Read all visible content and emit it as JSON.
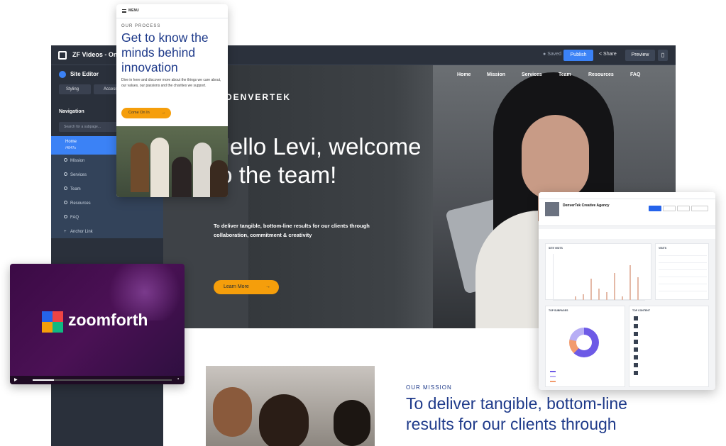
{
  "editor": {
    "title": "ZF Videos - Onboa",
    "saved": "Saved",
    "publish": "Publish",
    "share": "Share",
    "preview": "Preview"
  },
  "sidebar": {
    "heading": "Site Editor",
    "tab_styling": "Styling",
    "tab_access": "Access",
    "nav_heading": "Navigation",
    "search_placeholder": "Search for a subpage...",
    "items": [
      {
        "label": "Home",
        "sub": "/4847s"
      },
      {
        "label": "Mission"
      },
      {
        "label": "Services"
      },
      {
        "label": "Team"
      },
      {
        "label": "Resources"
      },
      {
        "label": "FAQ"
      },
      {
        "label": "Anchor Link"
      }
    ]
  },
  "hero": {
    "nav": [
      "Home",
      "Mission",
      "Services",
      "Team",
      "Resources",
      "FAQ"
    ],
    "brand": "DENVERTEK",
    "headline": "Hello Levi, welcome to the team!",
    "subtext": "To deliver tangible, bottom-line results for our clients through collaboration, commitment & creativity",
    "cta": "Learn More"
  },
  "mission": {
    "label": "OUR MISSION",
    "headline": "To deliver tangible, bottom-line results for our clients through"
  },
  "menu_card": {
    "menu_label": "MENU",
    "overline": "OUR PROCESS",
    "headline": "Get to know the minds behind innovation",
    "body": "Dive in here and discover more about the things we care about, our values, our passions and the charities we support.",
    "cta": "Come On In"
  },
  "video": {
    "brand": "zoomforth"
  },
  "dashboard": {
    "name": "DenverTek Creative Agency",
    "card_views": "SITE VISITS",
    "card_visits": "VISITS",
    "card_subpages": "TOP SUBPAGES",
    "card_content": "TOP CONTENT",
    "spikes": [
      0.1,
      0.15,
      0.55,
      0.3,
      0.2,
      0.7,
      0.1,
      0.9,
      0.6
    ]
  },
  "colors": {
    "accent": "#3b82f6",
    "cta": "#f59e0b",
    "navy": "#1e3a8a",
    "sidebar": "#2a303b"
  }
}
